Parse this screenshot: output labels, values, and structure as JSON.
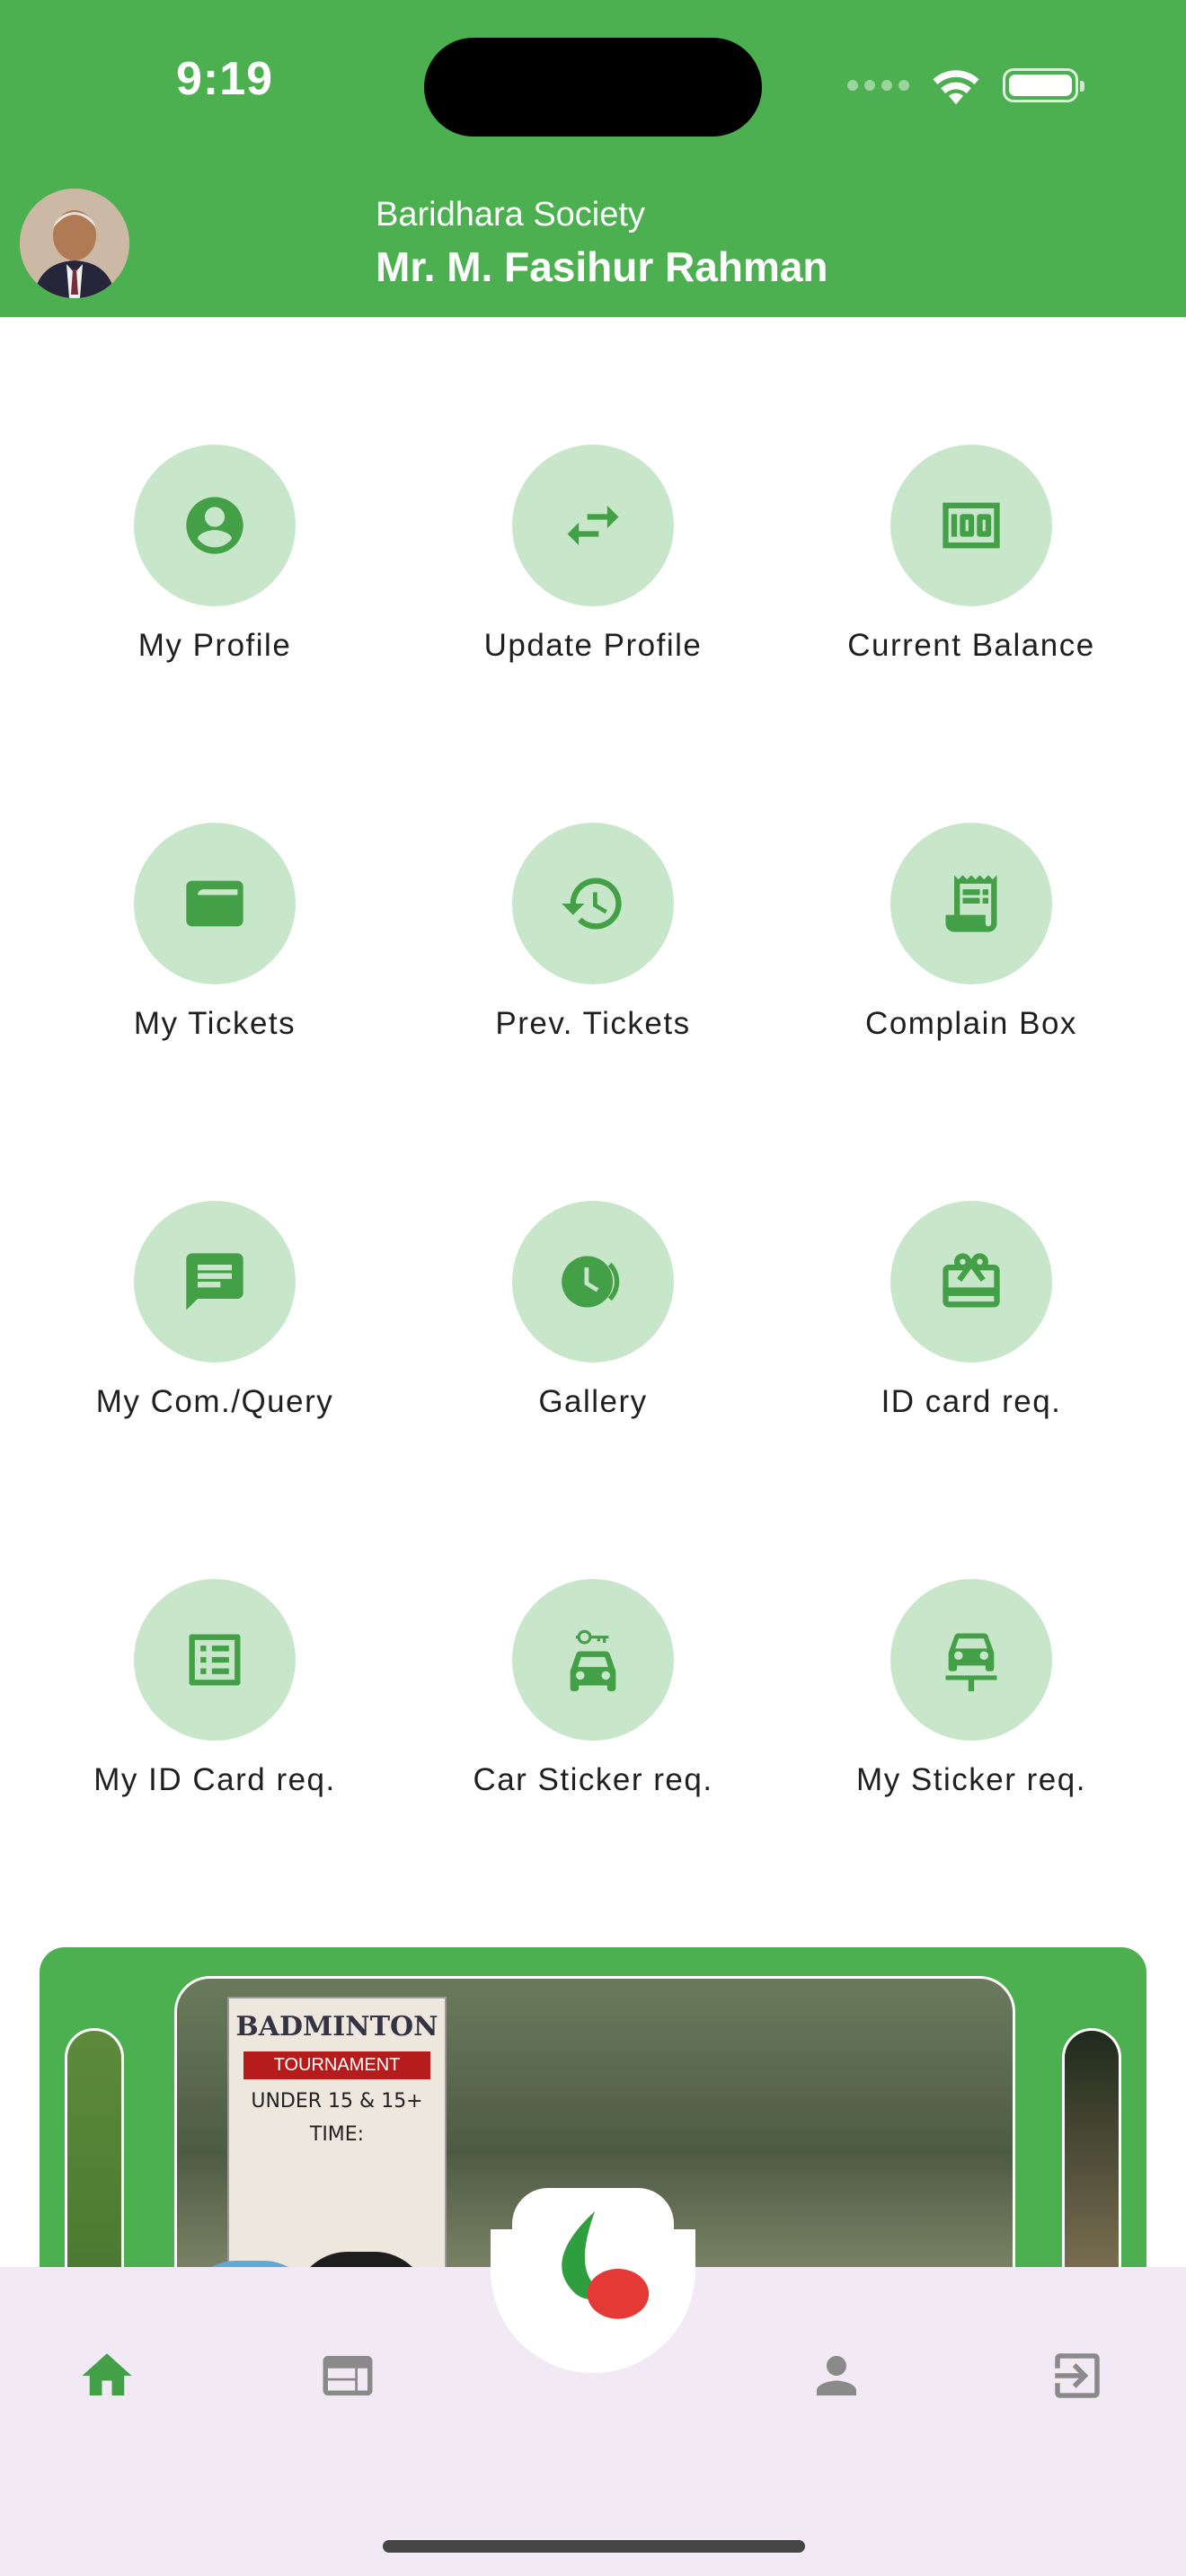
{
  "status_bar": {
    "time": "9:19"
  },
  "header": {
    "society": "Baridhara Society",
    "user_name": "Mr. M. Fasihur Rahman"
  },
  "colors": {
    "primary": "#4caf50",
    "tile_bg": "#c8e6c9",
    "icon": "#43a047",
    "nav_bg": "#f1eaf5"
  },
  "menu": [
    {
      "label": "My Profile",
      "icon": "account-circle-icon"
    },
    {
      "label": "Update Profile",
      "icon": "swap-arrows-icon"
    },
    {
      "label": "Current Balance",
      "icon": "money-icon"
    },
    {
      "label": "My Tickets",
      "icon": "card-icon"
    },
    {
      "label": "Prev. Tickets",
      "icon": "history-icon"
    },
    {
      "label": "Complain Box",
      "icon": "receipt-icon"
    },
    {
      "label": "My Com./Query",
      "icon": "message-icon"
    },
    {
      "label": "Gallery",
      "icon": "gallery-clock-icon"
    },
    {
      "label": "ID card req.",
      "icon": "card-giftcard-icon"
    },
    {
      "label": "My ID Card req.",
      "icon": "list-alt-icon"
    },
    {
      "label": "Car Sticker req.",
      "icon": "car-key-icon"
    },
    {
      "label": "My Sticker req.",
      "icon": "car-stand-icon"
    }
  ],
  "carousel": {
    "banner_title": "BADMINTON",
    "banner_sub": "TOURNAMENT",
    "banner_text": "UNDER 15 & 15+",
    "banner_time": "TIME:"
  },
  "bottom_nav": [
    {
      "name": "home",
      "active": true
    },
    {
      "name": "notice",
      "active": false
    },
    {
      "name": "profile",
      "active": false
    },
    {
      "name": "logout",
      "active": false
    }
  ]
}
